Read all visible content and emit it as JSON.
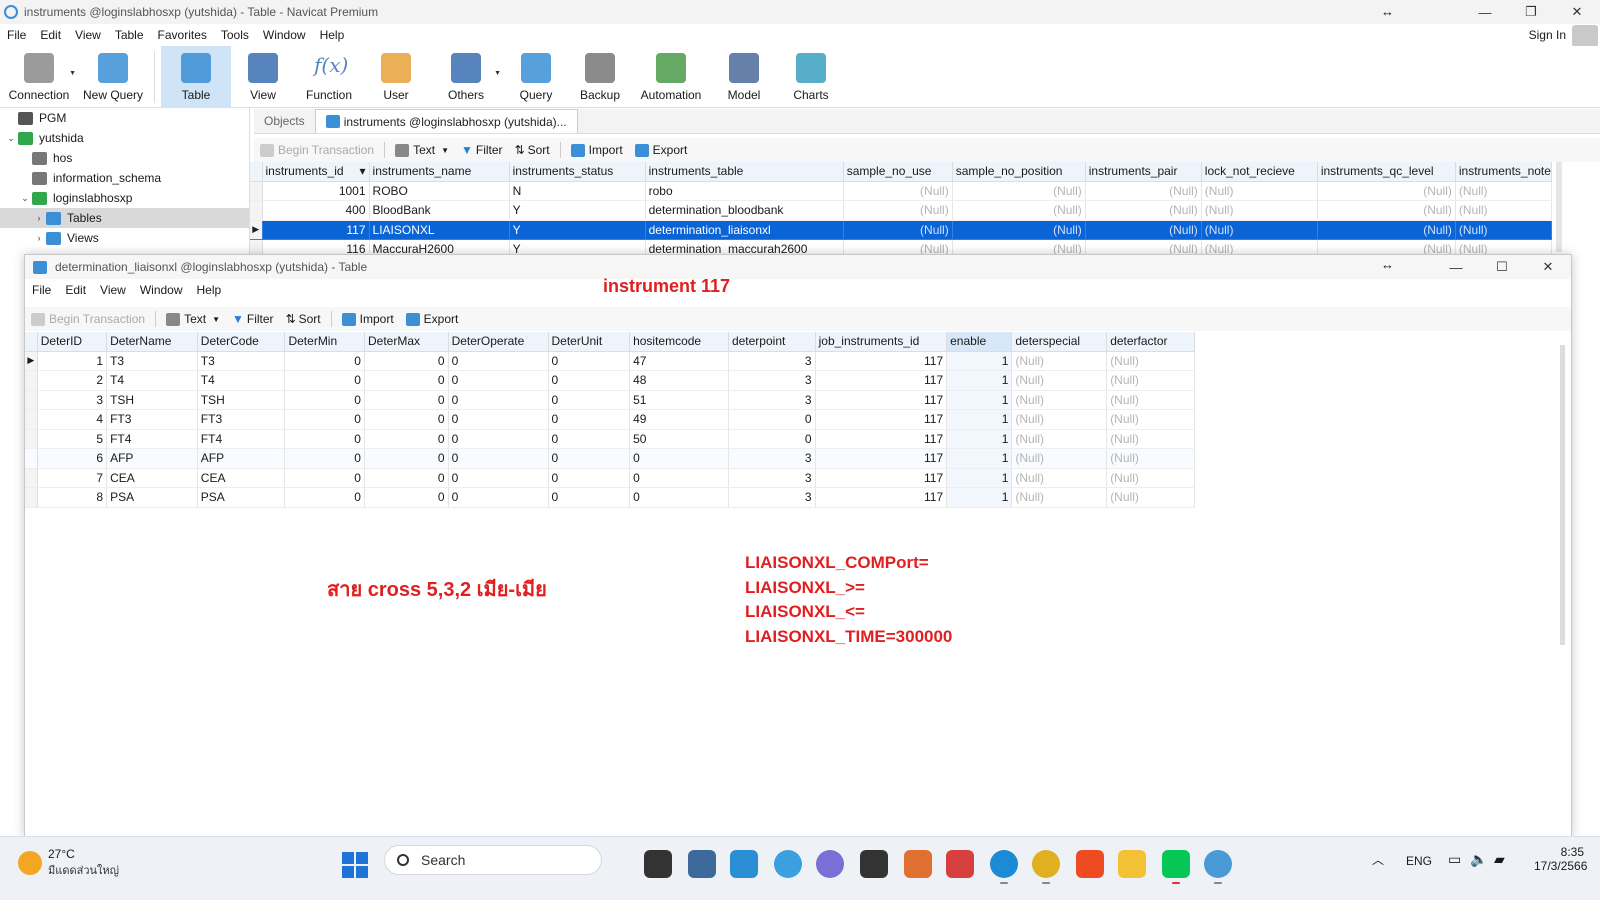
{
  "main_window": {
    "title": "instruments @loginslabhosxp (yutshida) - Table - Navicat Premium",
    "menu": [
      "File",
      "Edit",
      "View",
      "Table",
      "Favorites",
      "Tools",
      "Window",
      "Help"
    ],
    "sign_in": "Sign In"
  },
  "toolbar": [
    {
      "label": "Connection",
      "icon": "connection-icon",
      "dropdown": true
    },
    {
      "label": "New Query",
      "icon": "new-query-icon",
      "dropdown": false
    },
    {
      "label": "Table",
      "icon": "table-icon",
      "active": true
    },
    {
      "label": "View",
      "icon": "view-icon"
    },
    {
      "label": "Function",
      "icon": "function-icon"
    },
    {
      "label": "User",
      "icon": "user-icon"
    },
    {
      "label": "Others",
      "icon": "others-icon",
      "dropdown": true
    },
    {
      "label": "Query",
      "icon": "query-icon"
    },
    {
      "label": "Backup",
      "icon": "backup-icon"
    },
    {
      "label": "Automation",
      "icon": "automation-icon"
    },
    {
      "label": "Model",
      "icon": "model-icon"
    },
    {
      "label": "Charts",
      "icon": "charts-icon"
    }
  ],
  "tree": [
    {
      "label": "PGM",
      "level": 0,
      "arrow": "",
      "icon_color": "#555"
    },
    {
      "label": "yutshida",
      "level": 0,
      "arrow": "v",
      "icon_color": "#2ea84a"
    },
    {
      "label": "hos",
      "level": 1,
      "arrow": "",
      "icon_color": "#777"
    },
    {
      "label": "information_schema",
      "level": 1,
      "arrow": "",
      "icon_color": "#777"
    },
    {
      "label": "loginslabhosxp",
      "level": 1,
      "arrow": "v",
      "icon_color": "#2ea84a"
    },
    {
      "label": "Tables",
      "level": 2,
      "arrow": ">",
      "icon_color": "#3a8fd6",
      "selected": true
    },
    {
      "label": "Views",
      "level": 2,
      "arrow": ">",
      "icon_color": "#3a8fd6"
    }
  ],
  "tabs": {
    "objects": "Objects",
    "table_tab": "instruments @loginslabhosxp (yutshida)..."
  },
  "subtoolbar": {
    "begin_transaction": "Begin Transaction",
    "text": "Text",
    "filter": "Filter",
    "sort": "Sort",
    "import": "Import",
    "export": "Export"
  },
  "instruments_table": {
    "columns": [
      "instruments_id",
      "instruments_name",
      "instruments_status",
      "instruments_table",
      "sample_no_use",
      "sample_no_position",
      "instruments_pair",
      "lock_not_recieve",
      "instruments_qc_level",
      "instruments_note"
    ],
    "rows": [
      [
        "1001",
        "ROBO",
        "N",
        "robo",
        "(Null)",
        "(Null)",
        "(Null)",
        "(Null)",
        "(Null)",
        "(Null)"
      ],
      [
        "400",
        "BloodBank",
        "Y",
        "determination_bloodbank",
        "(Null)",
        "(Null)",
        "(Null)",
        "(Null)",
        "(Null)",
        "(Null)"
      ],
      [
        "117",
        "LIAISONXL",
        "Y",
        "determination_liaisonxl",
        "(Null)",
        "(Null)",
        "(Null)",
        "(Null)",
        "(Null)",
        "(Null)"
      ],
      [
        "116",
        "MaccuraH2600",
        "Y",
        "determination_maccurah2600",
        "(Null)",
        "(Null)",
        "(Null)",
        "(Null)",
        "(Null)",
        "(Null)"
      ]
    ],
    "selected_row": 2
  },
  "child_window": {
    "title": "determination_liaisonxl @loginslabhosxp (yutshida) - Table",
    "menu": [
      "File",
      "Edit",
      "View",
      "Window",
      "Help"
    ],
    "columns": [
      "DeterID",
      "DeterName",
      "DeterCode",
      "DeterMin",
      "DeterMax",
      "DeterOperate",
      "DeterUnit",
      "hositemcode",
      "deterpoint",
      "job_instruments_id",
      "enable",
      "deterspecial",
      "deterfactor"
    ],
    "rows": [
      [
        "1",
        "T3",
        "T3",
        "0",
        "0",
        "0",
        "0",
        "47",
        "3",
        "117",
        "1",
        "(Null)",
        "(Null)"
      ],
      [
        "2",
        "T4",
        "T4",
        "0",
        "0",
        "0",
        "0",
        "48",
        "3",
        "117",
        "1",
        "(Null)",
        "(Null)"
      ],
      [
        "3",
        "TSH",
        "TSH",
        "0",
        "0",
        "0",
        "0",
        "51",
        "3",
        "117",
        "1",
        "(Null)",
        "(Null)"
      ],
      [
        "4",
        "FT3",
        "FT3",
        "0",
        "0",
        "0",
        "0",
        "49",
        "0",
        "117",
        "1",
        "(Null)",
        "(Null)"
      ],
      [
        "5",
        "FT4",
        "FT4",
        "0",
        "0",
        "0",
        "0",
        "50",
        "0",
        "117",
        "1",
        "(Null)",
        "(Null)"
      ],
      [
        "6",
        "AFP",
        "AFP",
        "0",
        "0",
        "0",
        "0",
        "0",
        "3",
        "117",
        "1",
        "(Null)",
        "(Null)"
      ],
      [
        "7",
        "CEA",
        "CEA",
        "0",
        "0",
        "0",
        "0",
        "0",
        "3",
        "117",
        "1",
        "(Null)",
        "(Null)"
      ],
      [
        "8",
        "PSA",
        "PSA",
        "0",
        "0",
        "0",
        "0",
        "0",
        "3",
        "117",
        "1",
        "(Null)",
        "(Null)"
      ]
    ]
  },
  "annotations": {
    "heading": "instrument 117",
    "cable_note": "สาย cross 5,3,2 เมีย-เมีย",
    "config_lines": [
      "LIAISONXL_COMPort=",
      "LIAISONXL_>=",
      "LIAISONXL_<=",
      "LIAISONXL_TIME=300000"
    ]
  },
  "taskbar": {
    "weather_temp": "27°C",
    "weather_desc": "มีแดดส่วนใหญ่",
    "search": "Search",
    "lang": "ENG",
    "time": "8:35",
    "date": "17/3/2566",
    "apps": [
      {
        "icon": "start-icon",
        "color": "#1e73d8"
      },
      {
        "icon": "task-view-icon",
        "color": "#333"
      },
      {
        "icon": "calculator-icon",
        "color": "#3d6a9a"
      },
      {
        "icon": "snipping-tool-icon",
        "color": "#2b8fd6"
      },
      {
        "icon": "globe-app-icon",
        "color": "#3aa0e0"
      },
      {
        "icon": "firefox-like-icon",
        "color": "#7a6fd6"
      },
      {
        "icon": "tool-app-icon",
        "color": "#333"
      },
      {
        "icon": "lab-app-icon",
        "color": "#e07030"
      },
      {
        "icon": "office-app-icon",
        "color": "#d84040"
      },
      {
        "icon": "edge-icon",
        "color": "#1d8ad6"
      },
      {
        "icon": "chrome-icon",
        "color": "#e0b020"
      },
      {
        "icon": "anydesk-icon",
        "color": "#ef4b23"
      },
      {
        "icon": "file-explorer-icon",
        "color": "#f2c234"
      },
      {
        "icon": "line-icon",
        "color": "#06c755"
      },
      {
        "icon": "navicat-icon",
        "color": "#4a9ad6"
      }
    ]
  }
}
